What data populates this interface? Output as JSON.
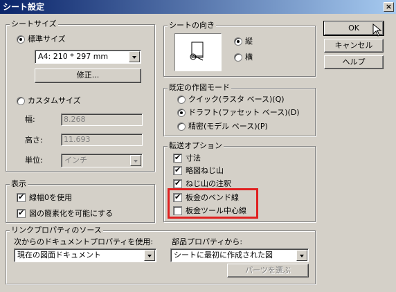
{
  "window": {
    "title": "シート設定",
    "close_label": "×"
  },
  "sheet_size": {
    "legend": "シートサイズ",
    "standard_label": "標準サイズ",
    "standard_selected": true,
    "size_value": "A4: 210 * 297 mm",
    "modify_button": "修正...",
    "custom_label": "カスタムサイズ",
    "custom_selected": false,
    "width_label": "幅:",
    "width_value": "8.268",
    "height_label": "高さ:",
    "height_value": "11.693",
    "unit_label": "単位:",
    "unit_value": "インチ"
  },
  "orientation": {
    "legend": "シートの向き",
    "portrait_label": "縦",
    "portrait_selected": true,
    "landscape_label": "横",
    "landscape_selected": false
  },
  "view_mode": {
    "legend": "既定の作図モード",
    "options": [
      {
        "label": "クイック(ラスタ ベース)(Q)",
        "selected": false
      },
      {
        "label": "ドラフト(ファセット ベース)(D)",
        "selected": true
      },
      {
        "label": "精密(モデル ベース)(P)",
        "selected": false
      }
    ]
  },
  "transfer_options": {
    "legend": "転送オプション",
    "items": [
      {
        "label": "寸法",
        "checked": true
      },
      {
        "label": "略図ねじ山",
        "checked": true
      },
      {
        "label": "ねじ山の注釈",
        "checked": true
      },
      {
        "label": "板金のベンド線",
        "checked": true
      },
      {
        "label": "板金ツール中心線",
        "checked": false
      }
    ]
  },
  "display": {
    "legend": "表示",
    "items": [
      {
        "label": "線幅0を使用",
        "checked": true
      },
      {
        "label": "図の簡素化を可能にする",
        "checked": true
      }
    ]
  },
  "link_props": {
    "legend": "リンクプロパティのソース",
    "doc_label": "次からのドキュメントプロパティを使用:",
    "doc_value": "現在の図面ドキュメント",
    "part_label": "部品プロパティから:",
    "part_value": "シートに最初に作成された図",
    "select_parts_button": "パーツを選ぶ"
  },
  "buttons": {
    "ok": "OK",
    "cancel": "キャンセル",
    "help": "ヘルプ"
  },
  "colors": {
    "titlebar": "#0a246a",
    "face": "#d4d0c8",
    "highlight": "#e02020"
  }
}
